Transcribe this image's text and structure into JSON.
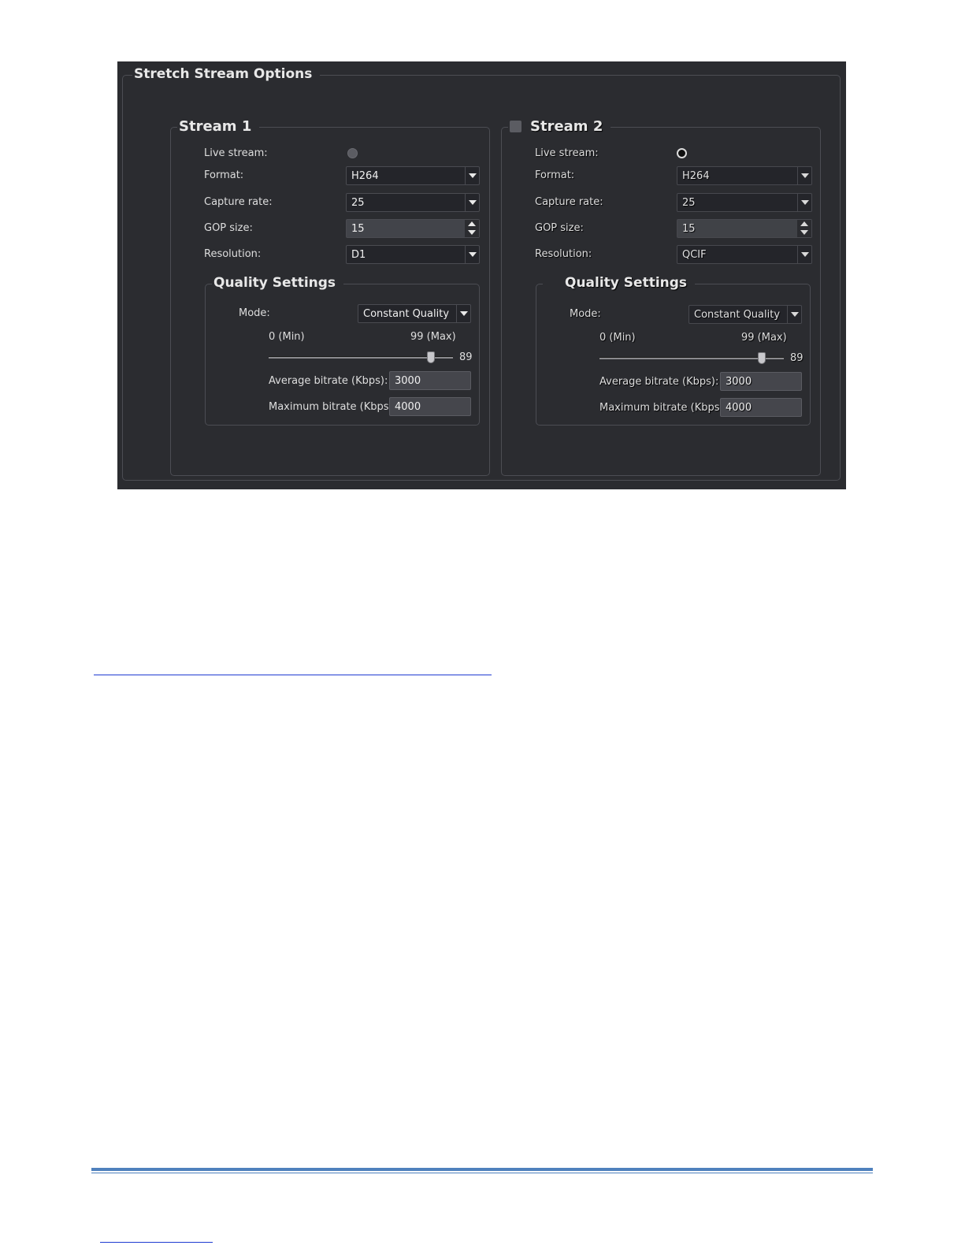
{
  "panel": {
    "title": "Stretch Stream Options"
  },
  "streams": [
    {
      "title": "Stream 1",
      "has_checkbox": false,
      "live_stream": {
        "label": "Live stream:",
        "checked": false
      },
      "format": {
        "label": "Format:",
        "value": "H264"
      },
      "capture_rate": {
        "label": "Capture rate:",
        "value": "25"
      },
      "gop_size": {
        "label": "GOP size:",
        "value": "15"
      },
      "resolution": {
        "label": "Resolution:",
        "value": "D1"
      },
      "quality": {
        "title": "Quality Settings",
        "mode_label": "Mode:",
        "mode_value": "Constant Quality",
        "min_label": "0 (Min)",
        "max_label": "99 (Max)",
        "slider_value": "89",
        "slider_min": 0,
        "slider_max": 99,
        "avg_bitrate_label": "Average bitrate (Kbps):",
        "avg_bitrate_value": "3000",
        "max_bitrate_label": "Maximum bitrate (Kbps):",
        "max_bitrate_value": "4000"
      }
    },
    {
      "title": "Stream 2",
      "has_checkbox": true,
      "checkbox_checked": false,
      "live_stream": {
        "label": "Live stream:",
        "checked": true
      },
      "format": {
        "label": "Format:",
        "value": "H264"
      },
      "capture_rate": {
        "label": "Capture rate:",
        "value": "25"
      },
      "gop_size": {
        "label": "GOP size:",
        "value": "15"
      },
      "resolution": {
        "label": "Resolution:",
        "value": "QCIF"
      },
      "quality": {
        "title": "Quality Settings",
        "mode_label": "Mode:",
        "mode_value": "Constant Quality",
        "min_label": "0 (Min)",
        "max_label": "99 (Max)",
        "slider_value": "89",
        "slider_min": 0,
        "slider_max": 99,
        "avg_bitrate_label": "Average bitrate (Kbps):",
        "avg_bitrate_value": "3000",
        "max_bitrate_label": "Maximum bitrate (Kbps):",
        "max_bitrate_value": "4000"
      }
    }
  ],
  "colors": {
    "panel_bg": "#2b2c30",
    "link_underline": "#1f3bd1",
    "footer_rule": "#4f81bd"
  }
}
